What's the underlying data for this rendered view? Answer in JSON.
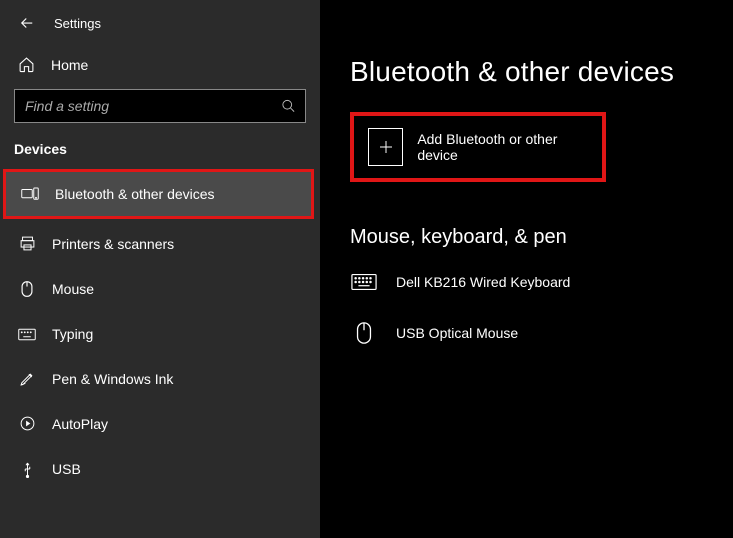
{
  "header": {
    "app_title": "Settings"
  },
  "home": {
    "label": "Home"
  },
  "search": {
    "placeholder": "Find a setting"
  },
  "sidebar": {
    "section": "Devices",
    "items": [
      {
        "label": "Bluetooth & other devices"
      },
      {
        "label": "Printers & scanners"
      },
      {
        "label": "Mouse"
      },
      {
        "label": "Typing"
      },
      {
        "label": "Pen & Windows Ink"
      },
      {
        "label": "AutoPlay"
      },
      {
        "label": "USB"
      }
    ]
  },
  "main": {
    "title": "Bluetooth & other devices",
    "add_device_label": "Add Bluetooth or other device",
    "sub_title": "Mouse, keyboard, & pen",
    "devices": [
      {
        "name": "Dell KB216 Wired Keyboard"
      },
      {
        "name": "USB Optical Mouse"
      }
    ]
  }
}
